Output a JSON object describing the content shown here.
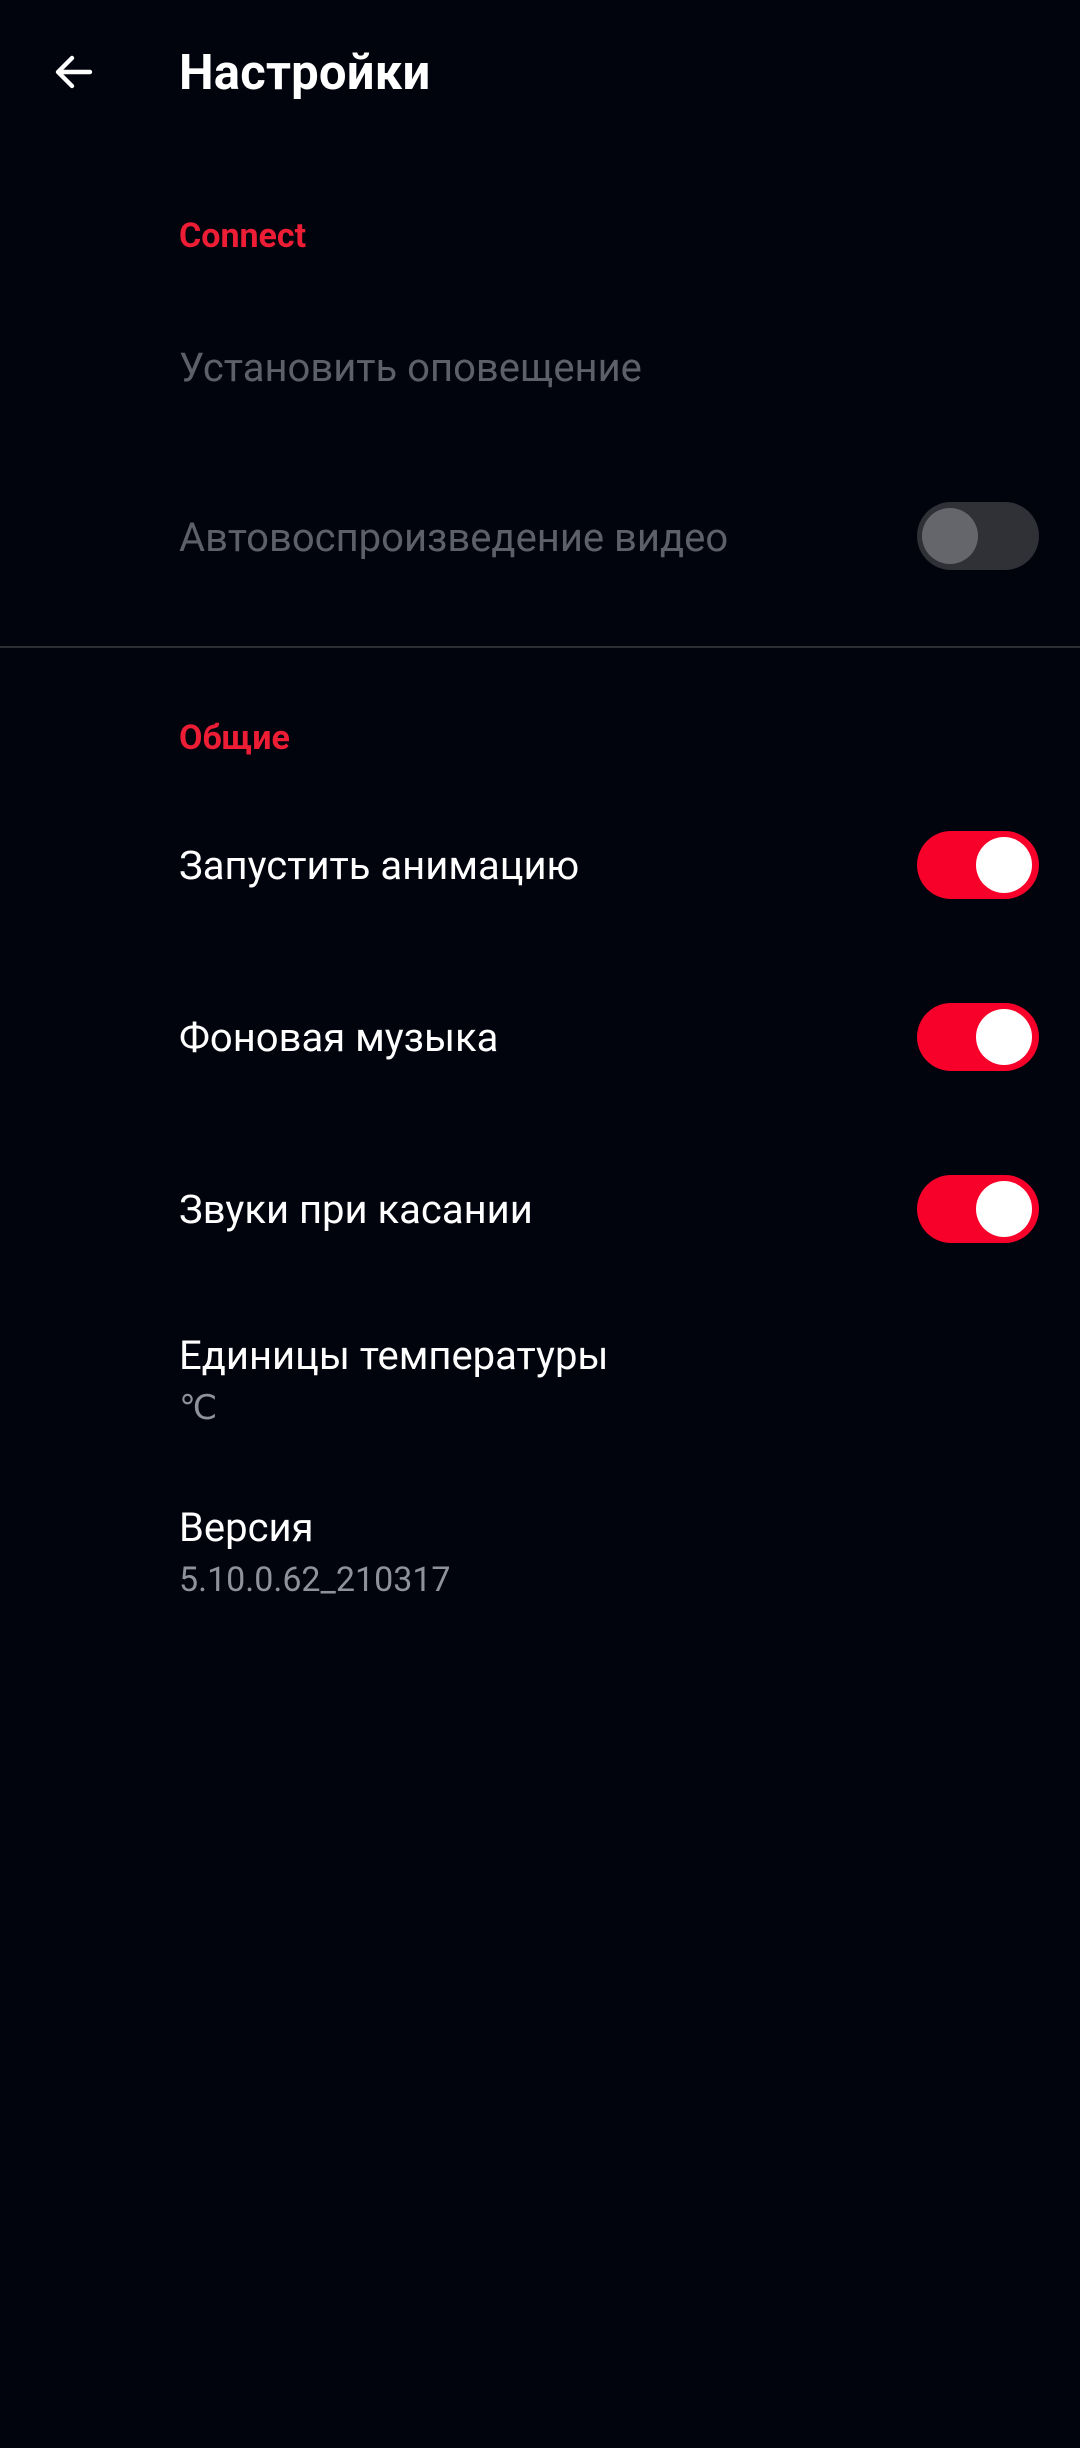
{
  "appbar": {
    "back_icon": "arrow-left-icon",
    "title": "Настройки"
  },
  "sections": {
    "connect": {
      "header": "Connect",
      "set_alert": "Установить оповещение",
      "autoplay_video": "Автовоспроизведение видео",
      "autoplay_video_enabled": false
    },
    "general": {
      "header": "Общие",
      "launch_animation": "Запустить анимацию",
      "launch_animation_enabled": true,
      "background_music": "Фоновая музыка",
      "background_music_enabled": true,
      "touch_sounds": "Звуки при касании",
      "touch_sounds_enabled": true,
      "temperature_units": "Единицы температуры",
      "temperature_units_value": "℃",
      "version": "Версия",
      "version_value": "5.10.0.62_210317"
    }
  },
  "colors": {
    "background": "#01040c",
    "accent": "#ec1d35",
    "switch_on": "#f7002a",
    "disabled_text": "#5d606a",
    "secondary_text": "#8f929a"
  }
}
